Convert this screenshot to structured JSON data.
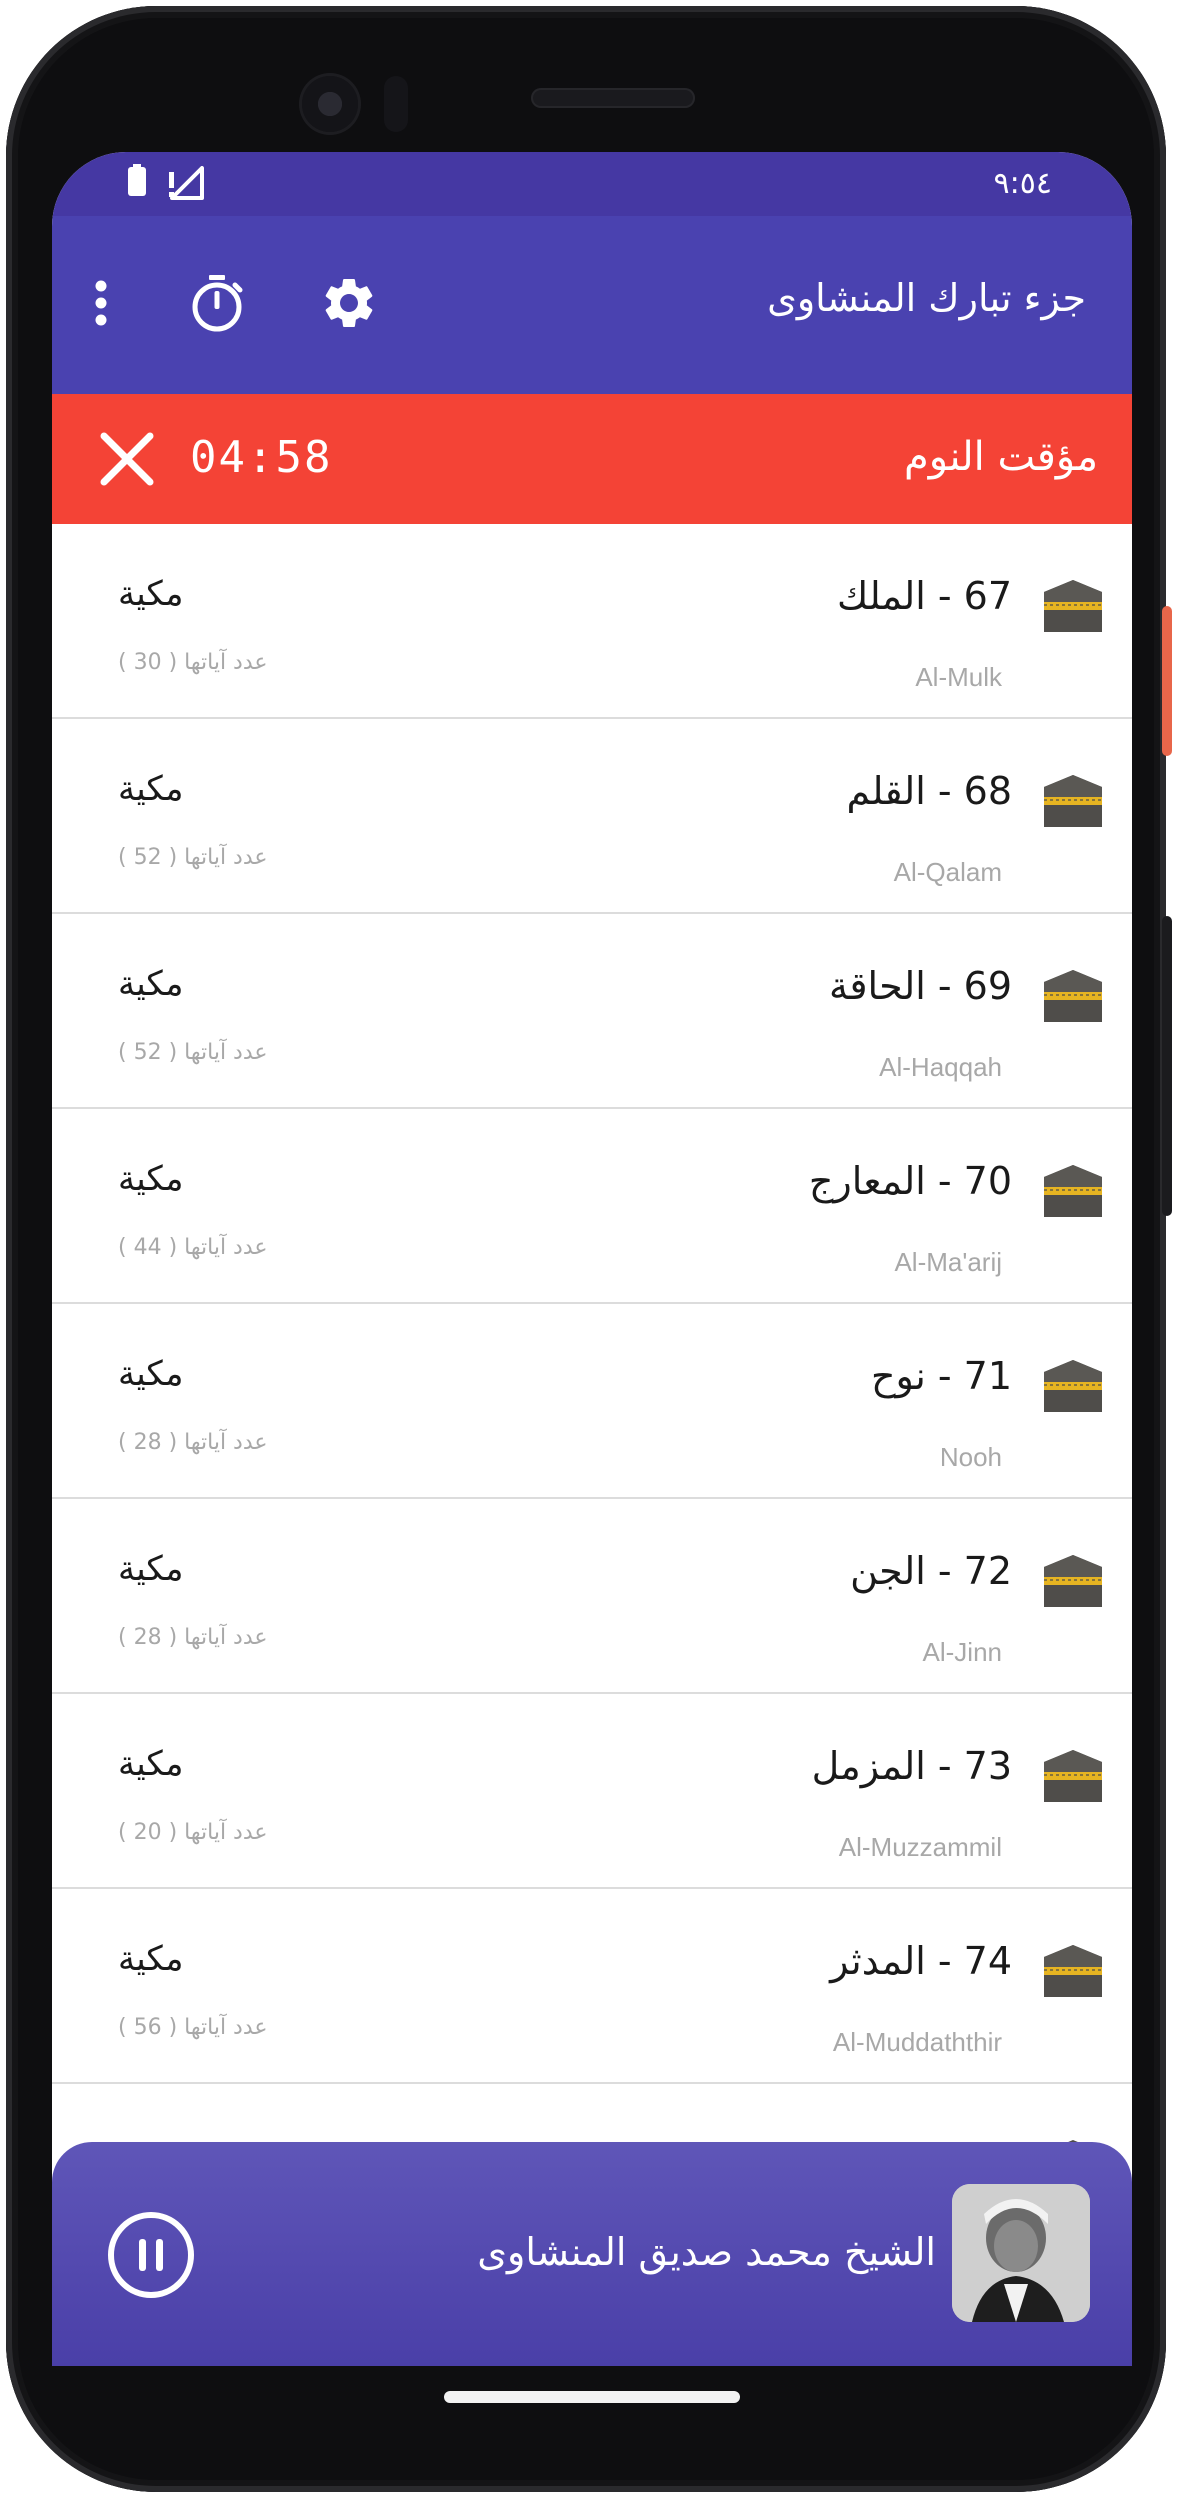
{
  "status_bar": {
    "time": "٩:٥٤"
  },
  "app_bar": {
    "title": "جزء تبارك المنشاوى"
  },
  "sleep_timer": {
    "label": "مؤقت النوم",
    "remaining": "04:58"
  },
  "surahs": [
    {
      "name": "67 - الملك",
      "english": "Al-Mulk",
      "type": "مكية",
      "ayat_count": "عدد آياتها ( 30 )"
    },
    {
      "name": "68 - القلم",
      "english": "Al-Qalam",
      "type": "مكية",
      "ayat_count": "عدد آياتها ( 52 )"
    },
    {
      "name": "69 - الحاقة",
      "english": "Al-Haqqah",
      "type": "مكية",
      "ayat_count": "عدد آياتها ( 52 )"
    },
    {
      "name": "70 - المعارج",
      "english": "Al-Ma'arij",
      "type": "مكية",
      "ayat_count": "عدد آياتها ( 44 )"
    },
    {
      "name": "71 - نوح",
      "english": "Nooh",
      "type": "مكية",
      "ayat_count": "عدد آياتها ( 28 )"
    },
    {
      "name": "72 - الجن",
      "english": "Al-Jinn",
      "type": "مكية",
      "ayat_count": "عدد آياتها ( 28 )"
    },
    {
      "name": "73 - المزمل",
      "english": "Al-Muzzammil",
      "type": "مكية",
      "ayat_count": "عدد آياتها ( 20 )"
    },
    {
      "name": "74 - المدثر",
      "english": "Al-Muddaththir",
      "type": "مكية",
      "ayat_count": "عدد آياتها ( 56 )"
    }
  ],
  "player": {
    "reciter": "الشيخ محمد صديق المنشاوى"
  },
  "colors": {
    "app_bar": "#4a42b0",
    "timer_bar": "#f44336",
    "player": "#4a3fa8"
  },
  "icons": {
    "overflow": "more-vert-icon",
    "timer": "timer-icon",
    "settings": "gear-icon",
    "close": "close-icon",
    "surah": "kaaba-icon",
    "pause": "pause-icon"
  }
}
